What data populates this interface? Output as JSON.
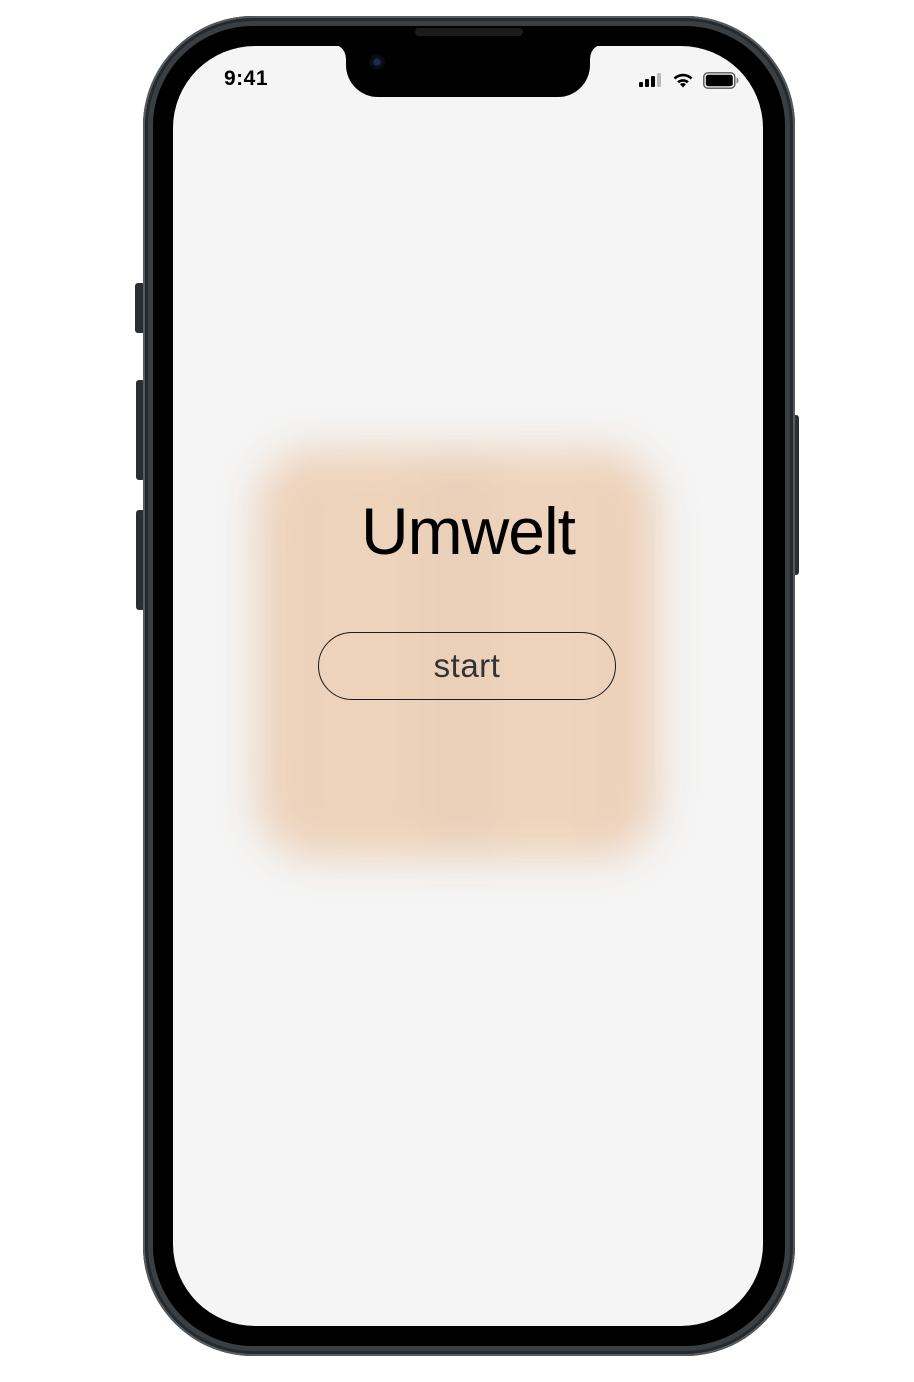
{
  "status_bar": {
    "time": "9:41",
    "icons": [
      "cellular-signal-icon",
      "wifi-icon",
      "battery-icon"
    ]
  },
  "app": {
    "title": "Umwelt",
    "start_label": "start"
  },
  "colors": {
    "screen_background": "#f5f5f5",
    "card_glow": "#ecd2bb",
    "text": "#000000",
    "device_frame": "#3a3f43"
  }
}
